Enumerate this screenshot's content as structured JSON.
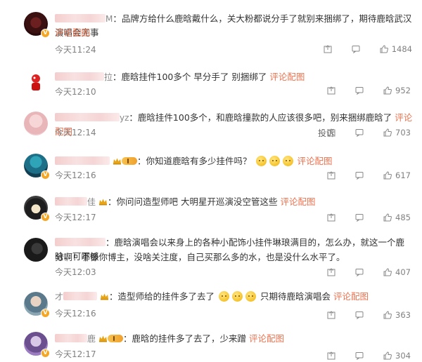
{
  "comments": [
    {
      "tail": "M",
      "text": "品牌方给什么鹿晗戴什么，关大粉都说分手了就别来捆绑了，期待鹿晗武汉演唱会完事",
      "link": "评论配图",
      "time": "今天11:24",
      "likes": "1484"
    },
    {
      "tail": "拉",
      "text": "鹿晗挂件100多个 早分手了 别捆绑了",
      "link": "评论配图",
      "time": "今天12:10",
      "likes": "952"
    },
    {
      "tail": "yz",
      "text": "鹿晗挂件100多个，和鹿晗撞款的人应该很多吧，别来捆绑鹿晗了",
      "link": "评论配图",
      "time": "今天12:14",
      "report": "投诉",
      "likes": "703"
    },
    {
      "tail": "",
      "text": "你知道鹿晗有多少挂件吗？",
      "link": "评论配图",
      "time": "今天12:16",
      "likes": "617"
    },
    {
      "tail": "佳",
      "text": "你问问造型师吧 大明星开巡演没空管这些",
      "link": "评论配图",
      "time": "今天12:17",
      "likes": "485"
    },
    {
      "tail": "",
      "text": "鹿晗演唱会以来身上的各种小配饰小挂件琳琅满目的，怎么办，就这一个鹿晗，可不够",
      "text2": "分啊！哪像你博主，没啥关注度，自己买那么多的水，也是没什么水平了。",
      "time": "今天12:03",
      "likes": "407"
    },
    {
      "tail": "才",
      "text": "造型师给的挂件多了去了",
      "text_after": "只期待鹿晗演唱会",
      "link": "评论配图",
      "time": "今天12:16",
      "likes": "363"
    },
    {
      "tail": "鹿",
      "text": "鹿晗的挂件多了去了，少来蹭",
      "link": "评论配图",
      "time": "今天12:17",
      "likes": "304"
    }
  ],
  "icons": {
    "share": "share-icon",
    "comment": "comment-icon",
    "like": "thumbs-up-icon",
    "crown": "crown-icon",
    "emoji": "smile-emoji-icon",
    "verified": "verified-v-badge-icon"
  },
  "colors": {
    "link": "#eb7350",
    "meta": "#808080"
  }
}
